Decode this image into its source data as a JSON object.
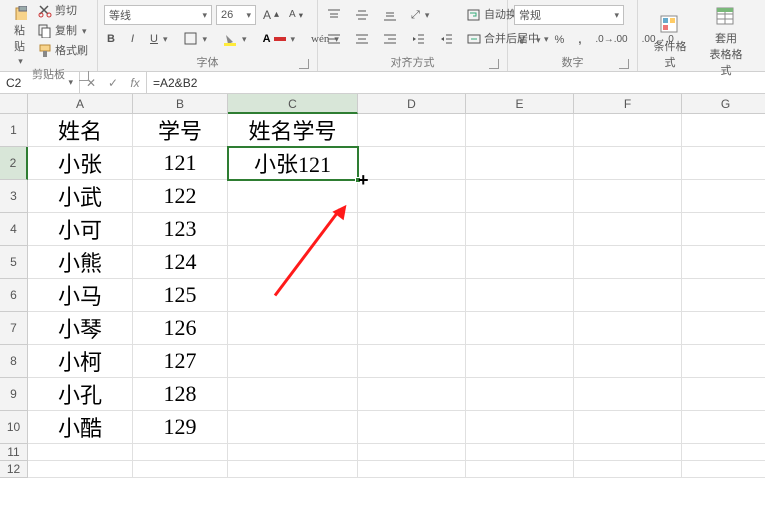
{
  "ribbon": {
    "clipboard": {
      "label": "剪贴板",
      "paste": "粘贴",
      "cut": "剪切",
      "copy": "复制",
      "format_painter": "格式刷"
    },
    "font": {
      "label": "字体",
      "font_name": "等线",
      "font_size": "26"
    },
    "alignment": {
      "label": "对齐方式",
      "wrap": "自动换行",
      "merge": "合并后居中"
    },
    "number": {
      "label": "数字",
      "format": "常规"
    },
    "styles": {
      "cond_format": "条件格式",
      "table_format": "套用\n表格格式"
    }
  },
  "formula_bar": {
    "cell_ref": "C2",
    "formula": "=A2&B2"
  },
  "columns": [
    "A",
    "B",
    "C",
    "D",
    "E",
    "F",
    "G"
  ],
  "row_numbers": [
    "1",
    "2",
    "3",
    "4",
    "5",
    "6",
    "7",
    "8",
    "9",
    "10",
    "11",
    "12"
  ],
  "data": {
    "headers": {
      "A": "姓名",
      "B": "学号",
      "C": "姓名学号"
    },
    "rows": [
      {
        "A": "小张",
        "B": "121",
        "C": "小张121"
      },
      {
        "A": "小武",
        "B": "122",
        "C": ""
      },
      {
        "A": "小可",
        "B": "123",
        "C": ""
      },
      {
        "A": "小熊",
        "B": "124",
        "C": ""
      },
      {
        "A": "小马",
        "B": "125",
        "C": ""
      },
      {
        "A": "小琴",
        "B": "126",
        "C": ""
      },
      {
        "A": "小柯",
        "B": "127",
        "C": ""
      },
      {
        "A": "小孔",
        "B": "128",
        "C": ""
      },
      {
        "A": "小酷",
        "B": "129",
        "C": ""
      }
    ]
  },
  "active_cell": "C2"
}
